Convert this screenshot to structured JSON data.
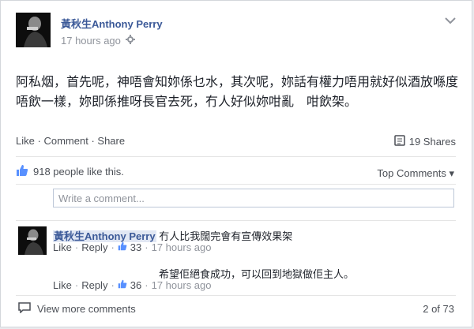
{
  "post": {
    "author": "黃秋生Anthony Perry",
    "time": "17 hours ago",
    "text": "阿私烟，首先呢，神唔會知妳係乜水，其次呢，妳話有權力唔用就好似酒放喺度唔飲一樣，妳即係推呀長官去死，冇人好似妳咁亂　咁飲架。"
  },
  "actions": {
    "like": "Like",
    "comment": "Comment",
    "share": "Share",
    "sep": "·"
  },
  "shares": "19 Shares",
  "likes_summary": "918 people like this.",
  "top_comments": "Top Comments",
  "comment_placeholder": "Write a comment...",
  "comments": [
    {
      "author": "黃秋生Anthony Perry",
      "text": "冇人比我闊完會有宣傳效果架",
      "like": "Like",
      "reply": "Reply",
      "likes": "33",
      "time": "17 hours ago"
    },
    {
      "text": "希望佢絕食成功，可以回到地獄做佢主人。",
      "like": "Like",
      "reply": "Reply",
      "likes": "36",
      "time": "17 hours ago"
    }
  ],
  "view_more": "View more comments",
  "comment_count": "2 of 73",
  "colors": {
    "link": "#3b5998",
    "muted": "#90949c",
    "text": "#1d2129"
  }
}
